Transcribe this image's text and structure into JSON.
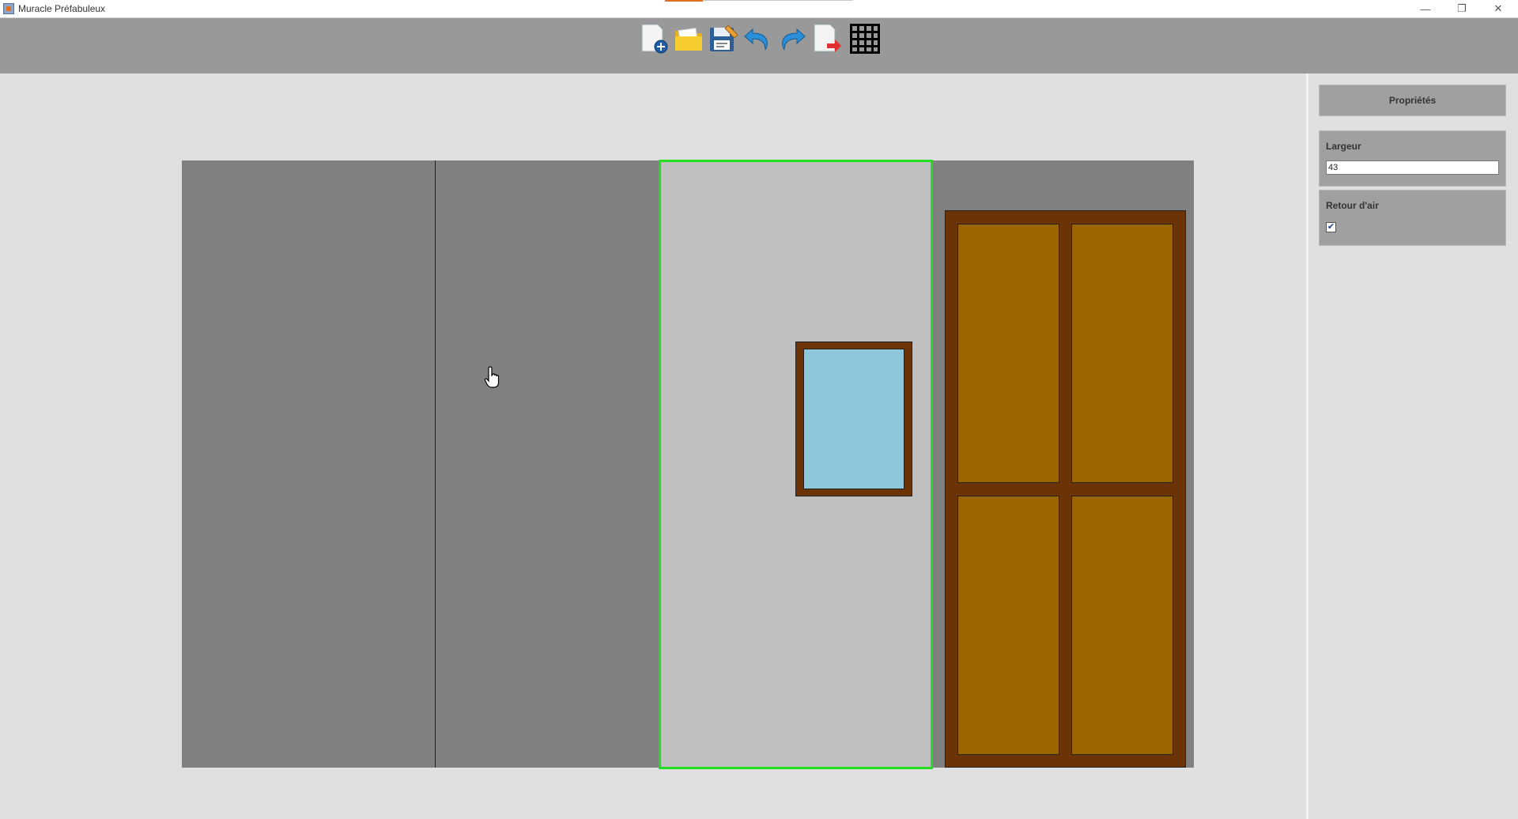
{
  "window": {
    "title": "Muracle Préfabuleux",
    "minimize": "—",
    "restore": "❐",
    "close": "✕"
  },
  "toolbar": {
    "tools": [
      {
        "name": "new-file",
        "icon": "new-document-icon"
      },
      {
        "name": "open-file",
        "icon": "folder-icon"
      },
      {
        "name": "save-file",
        "icon": "save-icon"
      },
      {
        "name": "undo",
        "icon": "undo-icon"
      },
      {
        "name": "redo",
        "icon": "redo-icon"
      },
      {
        "name": "export",
        "icon": "export-icon"
      },
      {
        "name": "grid",
        "icon": "grid-icon"
      }
    ]
  },
  "properties": {
    "header": "Propriétés",
    "width_label": "Largeur",
    "width_value": "43",
    "air_return_label": "Retour d'air",
    "air_return_checked": true,
    "check_mark": "✔"
  },
  "colors": {
    "wall": "#808080",
    "selected_panel": "#c0c0c0",
    "selection_border": "#22dd22",
    "frame_wood": "#6b3306",
    "door_panel": "#9a6400",
    "glass": "#8ec6da"
  }
}
